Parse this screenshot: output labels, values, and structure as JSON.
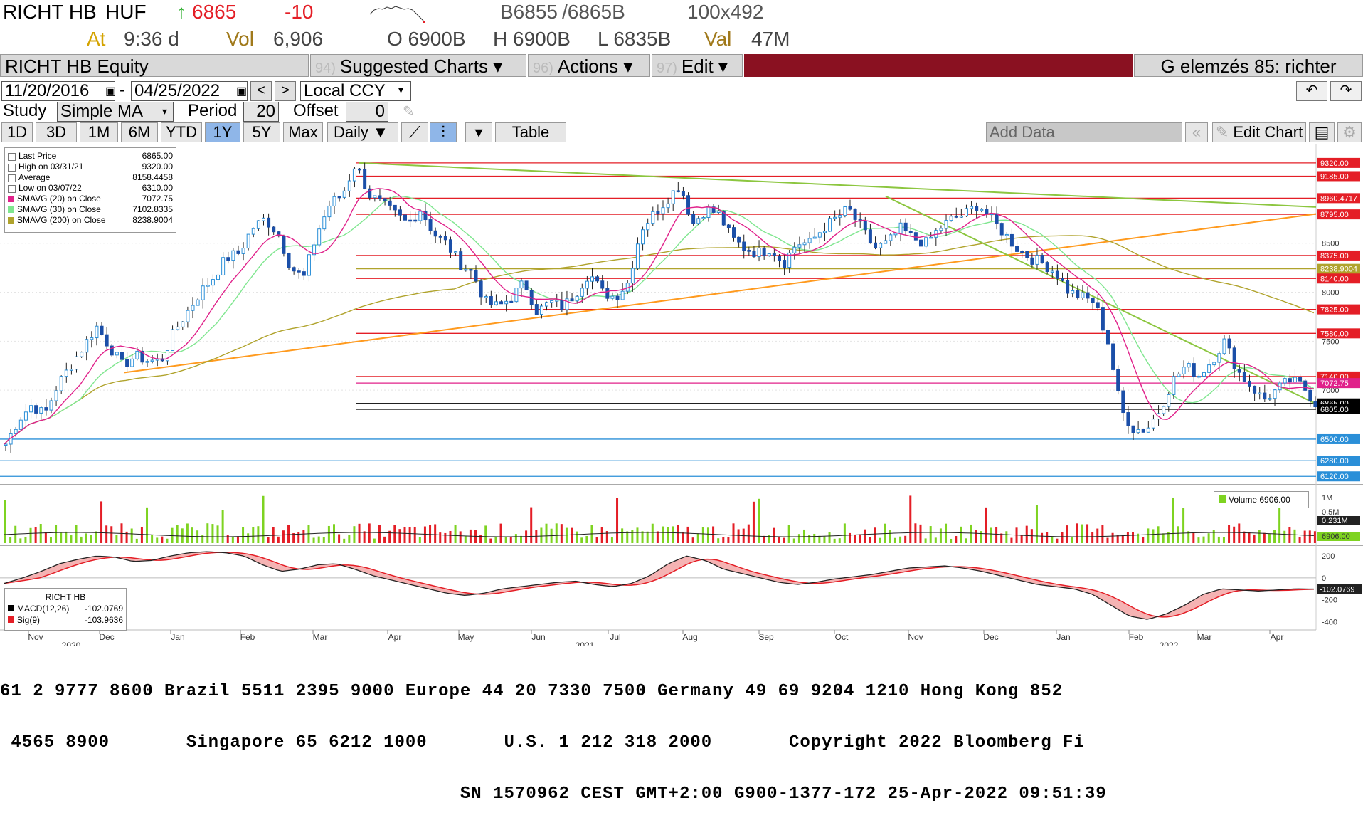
{
  "header": {
    "ticker": "RICHT HB",
    "currency": "HUF",
    "arrow": "↑",
    "last": "6865",
    "change": "-10",
    "bid": "B6855",
    "ask": "/6865B",
    "size": "100x492",
    "time_label": "At",
    "time": "9:36 d",
    "vol_label": "Vol",
    "vol": "6,906",
    "open": "O 6900B",
    "high": "H 6900B",
    "low": "L 6835B",
    "val_label": "Val",
    "val": "47M"
  },
  "toolbar": {
    "security": "RICHT HB Equity",
    "suggested_num": "94)",
    "suggested": "Suggested Charts ▾",
    "actions_num": "96)",
    "actions": "Actions ▾",
    "edit_num": "97)",
    "edit": "Edit ▾",
    "right_title": "G elemzés 85: richter"
  },
  "range": {
    "start": "11/20/2016",
    "end": "04/25/2022",
    "separator": "-",
    "ccy": "Local CCY"
  },
  "study": {
    "label": "Study",
    "value": "Simple MA",
    "period_label": "Period",
    "period": "20",
    "offset_label": "Offset",
    "offset": "0"
  },
  "tabs": [
    "1D",
    "3D",
    "1M",
    "6M",
    "YTD",
    "1Y",
    "5Y",
    "Max"
  ],
  "selected_tab": "1Y",
  "freq": "Daily ▼",
  "table_label": "Table",
  "add_data": "Add Data",
  "edit_chart": "Edit Chart",
  "legend": [
    {
      "label": "Last Price",
      "value": "6865.00",
      "icon": "candle-icon"
    },
    {
      "label": "High on 03/31/21",
      "value": "9320.00",
      "icon": "high-marker-icon"
    },
    {
      "label": "Average",
      "value": "8158.4458",
      "icon": "average-line-icon"
    },
    {
      "label": "Low on 03/07/22",
      "value": "6310.00",
      "icon": "low-marker-icon"
    },
    {
      "label": "SMAVG (20)  on Close",
      "value": "7072.75",
      "color": "#e0218a"
    },
    {
      "label": "SMAVG (30)  on Close",
      "value": "7102.8335",
      "color": "#7fe68f"
    },
    {
      "label": "SMAVG (200)  on Close",
      "value": "8238.9004",
      "color": "#b0a32c"
    }
  ],
  "volume_legend": {
    "label": "Volume",
    "value": "6906.00",
    "color": "#7ed321"
  },
  "macd_legend": {
    "title": "RICHT HB",
    "items": [
      {
        "label": "MACD(12,26)",
        "value": "-102.0769",
        "color": "#000000"
      },
      {
        "label": "Sig(9)",
        "value": "-103.9636",
        "color": "#e41e26"
      }
    ]
  },
  "chart_data": {
    "type": "candlestick",
    "price_ylim": [
      6100,
      9450
    ],
    "price_axis_ticks": [
      8500,
      8000,
      7500,
      7000
    ],
    "price_axis_labels": [
      "8500",
      "8000",
      "7500",
      "7000"
    ],
    "horizontal_levels": [
      {
        "value": 9320.0,
        "label": "9320.00",
        "color": "#e41e26"
      },
      {
        "value": 9185.0,
        "label": "9185.00",
        "color": "#e41e26"
      },
      {
        "value": 8960.4717,
        "label": "8960.4717",
        "color": "#e41e26"
      },
      {
        "value": 8795.0,
        "label": "8795.00",
        "color": "#e41e26"
      },
      {
        "value": 8375.0,
        "label": "8375.00",
        "color": "#e41e26"
      },
      {
        "value": 8238.9004,
        "label": "8238.9004",
        "color": "#b0a32c"
      },
      {
        "value": 8140.0,
        "label": "8140.00",
        "color": "#e41e26"
      },
      {
        "value": 7825.0,
        "label": "7825.00",
        "color": "#e41e26"
      },
      {
        "value": 7580.0,
        "label": "7580.00",
        "color": "#e41e26"
      },
      {
        "value": 7140.0,
        "label": "7140.00",
        "color": "#e41e26"
      },
      {
        "value": 7072.75,
        "label": "7072.75",
        "color": "#e0218a"
      },
      {
        "value": 6865.0,
        "label": "6865.00",
        "color": "#000000"
      },
      {
        "value": 6805.0,
        "label": "6805.00",
        "color": "#000000"
      },
      {
        "value": 6500.0,
        "label": "6500.00",
        "color": "#2a8fd8"
      },
      {
        "value": 6280.0,
        "label": "6280.00",
        "color": "#2a8fd8"
      },
      {
        "value": 6120.0,
        "label": "6120.00",
        "color": "#2a8fd8"
      }
    ],
    "months": [
      "Nov",
      "Dec",
      "Jan",
      "Feb",
      "Mar",
      "Apr",
      "May",
      "Jun",
      "Jul",
      "Aug",
      "Sep",
      "Oct",
      "Nov",
      "Dec",
      "Jan",
      "Feb",
      "Mar",
      "Apr"
    ],
    "years": [
      "2020",
      "2021",
      "2022"
    ],
    "close_path": [
      6450,
      6700,
      6850,
      6750,
      7050,
      7250,
      7450,
      7650,
      7450,
      7250,
      7350,
      7300,
      7300,
      7600,
      7800,
      8000,
      8150,
      8350,
      8400,
      8650,
      8750,
      8600,
      8250,
      8150,
      8600,
      8900,
      9000,
      9320,
      9000,
      8900,
      8800,
      8700,
      8850,
      8600,
      8500,
      8300,
      8200,
      7900,
      7850,
      7950,
      8100,
      7800,
      7900,
      7850,
      8000,
      8200,
      8000,
      7950,
      8100,
      8650,
      8800,
      8950,
      9100,
      8700,
      8850,
      8800,
      8550,
      8450,
      8400,
      8450,
      8300,
      8500,
      8500,
      8650,
      8750,
      8850,
      8650,
      8450,
      8500,
      8650,
      8550,
      8500,
      8650,
      8750,
      8800,
      8900,
      8750,
      8600,
      8450,
      8350,
      8300,
      8200,
      8000,
      7950,
      7900,
      7500,
      6800,
      6600,
      6600,
      6800,
      7100,
      7250,
      7150,
      7300,
      7500,
      7200,
      7050,
      6900,
      7000,
      7100,
      7050,
      6865
    ],
    "volume_axis_labels": [
      "1M",
      "0.5M",
      "0.231M",
      "6906.00"
    ],
    "macd_axis_labels": [
      "200",
      "0",
      "-200",
      "-400",
      "-102.0769"
    ],
    "macd_ylim": [
      -450,
      260
    ],
    "macd_path": [
      -50,
      0,
      60,
      130,
      170,
      200,
      190,
      150,
      160,
      200,
      230,
      240,
      230,
      200,
      120,
      60,
      80,
      120,
      130,
      80,
      20,
      -20,
      -60,
      -100,
      -140,
      -160,
      -140,
      -100,
      -80,
      -60,
      -40,
      -30,
      -60,
      -80,
      -50,
      20,
      130,
      200,
      160,
      80,
      40,
      0,
      -40,
      -60,
      -40,
      -10,
      10,
      30,
      60,
      90,
      100,
      110,
      90,
      60,
      20,
      -20,
      -60,
      -80,
      -100,
      -150,
      -250,
      -350,
      -380,
      -330,
      -250,
      -150,
      -100,
      -110,
      -120,
      -110,
      -100,
      -102
    ]
  },
  "ticker_lines": [
    "61 2 9777 8600 Brazil 5511 2395 9000 Europe 44 20 7330 7500 Germany 49 69 9204 1210 Hong Kong 852",
    " 4565 8900       Singapore 65 6212 1000       U.S. 1 212 318 2000       Copyright 2022 Bloomberg Fi",
    "                                          SN 1570962 CEST GMT+2:00 G900-1377-172 25-Apr-2022 09:51:39"
  ]
}
